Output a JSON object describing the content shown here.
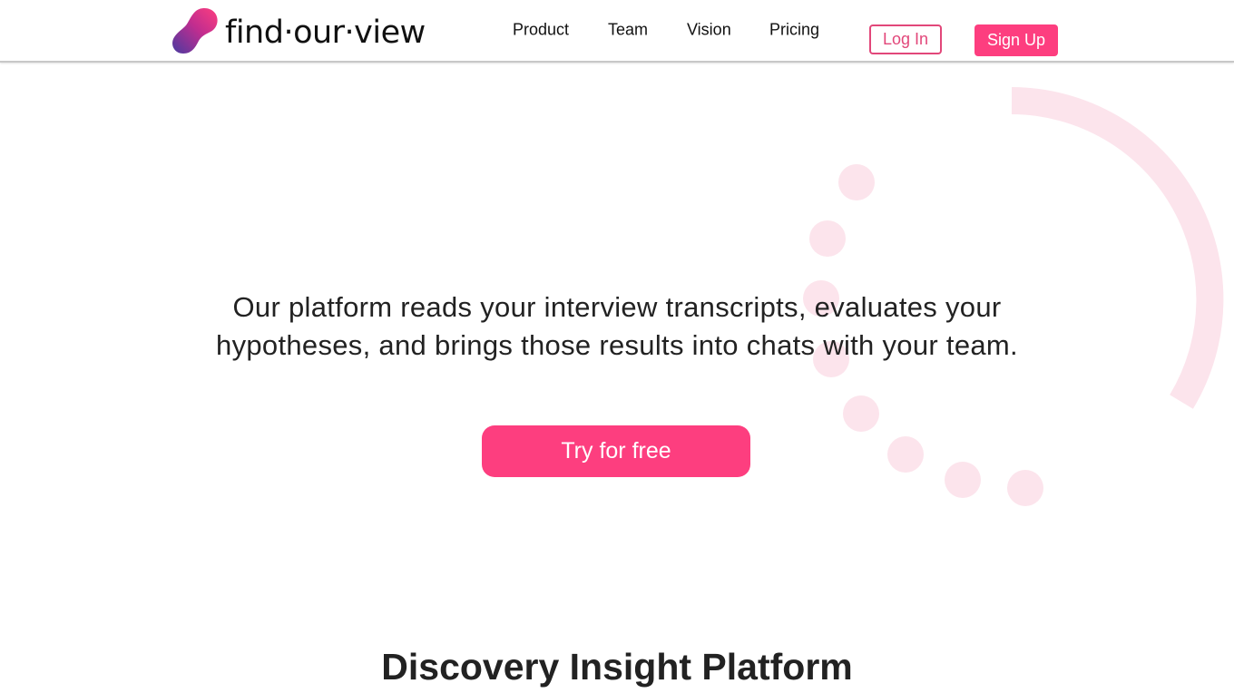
{
  "header": {
    "brand": "find·our·view",
    "nav": [
      "Product",
      "Team",
      "Vision",
      "Pricing"
    ],
    "login_label": "Log In",
    "signup_label": "Sign Up"
  },
  "hero": {
    "line1": "Our platform reads your interview transcripts, evaluates your",
    "line2": "hypotheses, and brings those results into chats with your team.",
    "cta_label": "Try for free"
  },
  "section": {
    "title": "Discovery Insight Platform"
  },
  "colors": {
    "accent": "#fd3e7f",
    "accent_outline": "#e2477a",
    "decor": "#fce4ec",
    "logo_gradient_start": "#5b3a9a",
    "logo_gradient_end": "#f0338a"
  }
}
